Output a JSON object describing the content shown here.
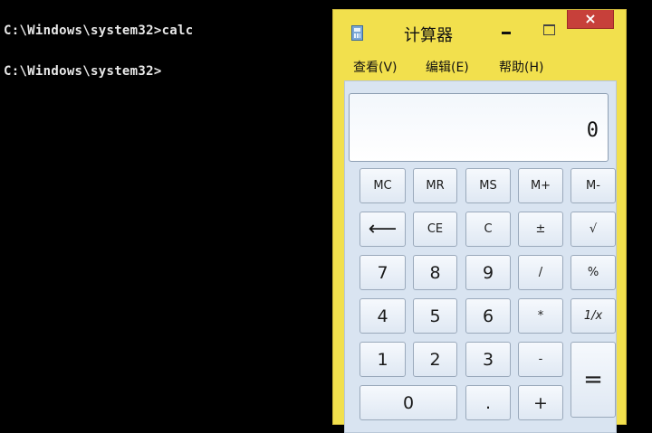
{
  "console": {
    "lines": [
      "C:\\Windows\\system32>calc",
      "C:\\Windows\\system32>"
    ]
  },
  "calculator": {
    "title": "计算器",
    "window_buttons": {
      "close": "×"
    },
    "menu": [
      "查看(V)",
      "编辑(E)",
      "帮助(H)"
    ],
    "display": "0",
    "memory_keys": [
      "MC",
      "MR",
      "MS",
      "M+",
      "M-"
    ],
    "row2": [
      "⟵",
      "CE",
      "C",
      "±",
      "√"
    ],
    "row3": [
      "7",
      "8",
      "9",
      "/",
      "%"
    ],
    "row4": [
      "4",
      "5",
      "6",
      "*",
      "1/x"
    ],
    "row5": [
      "1",
      "2",
      "3",
      "-",
      "="
    ],
    "row6": [
      "0",
      ".",
      "+"
    ]
  },
  "colors": {
    "window_frame": "#f2e04d",
    "close_button": "#c7403a",
    "console_bg": "#000000"
  }
}
